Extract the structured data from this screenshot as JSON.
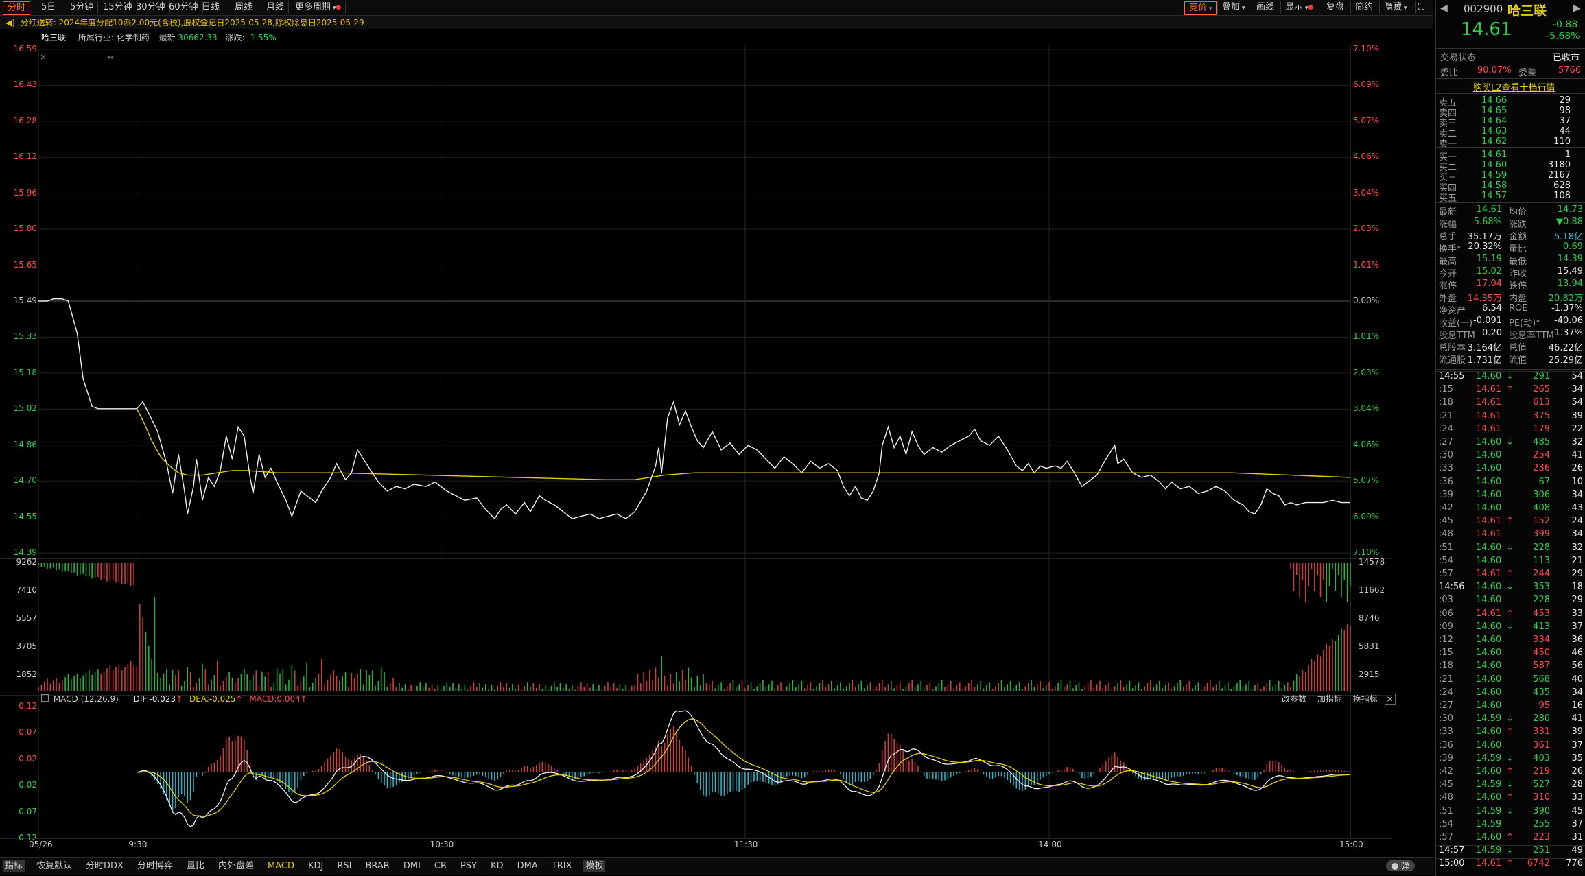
{
  "toolbar": {
    "period_tabs": [
      "分时",
      "5日",
      "5分钟",
      "15分钟",
      "30分钟",
      "60分钟",
      "日线",
      "周线",
      "月线",
      "更多周期"
    ],
    "right_tabs": [
      "竞价",
      "叠加",
      "画线",
      "显示",
      "复盘",
      "简约",
      "隐藏"
    ]
  },
  "notice": {
    "label": "分红送转:",
    "text": "2024年度分配10派2.00元(含税),股权登记日2025-05-28,除权除息日2025-05-29"
  },
  "info": {
    "name": "哈三联",
    "industry_label": "所属行业:",
    "industry": "化学制药",
    "latest_label": "最新",
    "latest": "30662.33",
    "change_label": "涨跌:",
    "change": "-1.55%"
  },
  "price_axis": {
    "left": [
      "16.59",
      "16.43",
      "16.28",
      "16.12",
      "15.96",
      "15.80",
      "15.65",
      "15.49",
      "15.33",
      "15.18",
      "15.02",
      "14.86",
      "14.70",
      "14.55",
      "14.39"
    ],
    "right": [
      "7.10%",
      "6.09%",
      "5.07%",
      "4.06%",
      "3.04%",
      "2.03%",
      "1.01%",
      "0.00%",
      "1.01%",
      "2.03%",
      "3.04%",
      "4.06%",
      "5.07%",
      "6.09%",
      "7.10%"
    ]
  },
  "volume_axis": {
    "left": [
      "9262",
      "7410",
      "5557",
      "3705",
      "1852"
    ],
    "right": [
      "14578",
      "11662",
      "8746",
      "5831",
      "2915"
    ]
  },
  "macd": {
    "label": "MACD (12,26,9)",
    "dif": "DIF:-0.023",
    "dea": "DEA:-0.025",
    "value": "MACD:0.004",
    "actions": [
      "改参数",
      "加指标",
      "换指标"
    ],
    "axis": [
      "0.12",
      "0.07",
      "0.02",
      "-0.02",
      "-0.07",
      "-0.12"
    ]
  },
  "time_axis": [
    "05/26",
    "9:30",
    "10:30",
    "11:30",
    "14:00",
    "15:00"
  ],
  "bottom_tabs": [
    "指标",
    "恢复默认",
    "分时DDX",
    "分时博弈",
    "量比",
    "内外盘差",
    "MACD",
    "KDJ",
    "RSI",
    "BRAR",
    "DMI",
    "CR",
    "PSY",
    "KD",
    "DMA",
    "TRIX",
    "模板"
  ],
  "bottom_right": "弹",
  "quote": {
    "code": "002900",
    "name": "哈三联",
    "price": "14.61",
    "change": "-0.88",
    "change_pct": "-5.68%",
    "trade_status_label": "交易状态",
    "trade_status": "已收市",
    "weibi_label": "委比",
    "weibi": "90.07%",
    "weicha_label": "委差",
    "weicha": "5766",
    "l2_link": "购买L2查看十档行情",
    "asks": [
      {
        "label": "卖五",
        "price": "14.66",
        "vol": "29"
      },
      {
        "label": "卖四",
        "price": "14.65",
        "vol": "98"
      },
      {
        "label": "卖三",
        "price": "14.64",
        "vol": "37"
      },
      {
        "label": "卖二",
        "price": "14.63",
        "vol": "44"
      },
      {
        "label": "卖一",
        "price": "14.62",
        "vol": "110"
      }
    ],
    "bids": [
      {
        "label": "买一",
        "price": "14.61",
        "vol": "1"
      },
      {
        "label": "买二",
        "price": "14.60",
        "vol": "3180"
      },
      {
        "label": "买三",
        "price": "14.59",
        "vol": "2167"
      },
      {
        "label": "买四",
        "price": "14.58",
        "vol": "628"
      },
      {
        "label": "买五",
        "price": "14.57",
        "vol": "108"
      }
    ],
    "stats": [
      {
        "l1": "最新",
        "v1": "14.61",
        "c1": "green",
        "l2": "均价",
        "v2": "14.73",
        "c2": "green"
      },
      {
        "l1": "涨幅",
        "v1": "-5.68%",
        "c1": "green",
        "l2": "涨跌",
        "v2": "▼0.88",
        "c2": "green"
      },
      {
        "l1": "总手",
        "v1": "35.17万",
        "c1": "white",
        "l2": "金额",
        "v2": "5.18亿",
        "c2": "cyan"
      },
      {
        "l1": "换手*",
        "v1": "20.32%",
        "c1": "white",
        "l2": "量比",
        "v2": "0.69",
        "c2": "green"
      },
      {
        "l1": "最高",
        "v1": "15.19",
        "c1": "green",
        "l2": "最低",
        "v2": "14.39",
        "c2": "green"
      },
      {
        "l1": "今开",
        "v1": "15.02",
        "c1": "green",
        "l2": "昨收",
        "v2": "15.49",
        "c2": "white"
      },
      {
        "l1": "涨停",
        "v1": "17.04",
        "c1": "red",
        "l2": "跌停",
        "v2": "13.94",
        "c2": "green"
      },
      {
        "l1": "外盘",
        "v1": "14.35万",
        "c1": "red",
        "l2": "内盘",
        "v2": "20.82万",
        "c2": "green"
      },
      {
        "l1": "净资产",
        "v1": "6.54",
        "c1": "white",
        "l2": "ROE",
        "v2": "-1.37%",
        "c2": "white"
      },
      {
        "l1": "收益(一)",
        "v1": "-0.091",
        "c1": "white",
        "l2": "PE(动)*",
        "v2": "-40.06",
        "c2": "white"
      },
      {
        "l1": "股息TTM",
        "v1": "0.20",
        "c1": "white",
        "l2": "股息率TTM",
        "v2": "1.37%",
        "c2": "white"
      },
      {
        "l1": "总股本",
        "v1": "3.164亿",
        "c1": "white",
        "l2": "总值",
        "v2": "46.22亿",
        "c2": "white"
      },
      {
        "l1": "流通股",
        "v1": "1.731亿",
        "c1": "white",
        "l2": "流值",
        "v2": "25.29亿",
        "c2": "white"
      }
    ],
    "ticks": [
      {
        "t": "14:55",
        "p": "14.60",
        "a": "↓",
        "v": "291",
        "n": "54",
        "c": "g",
        "m": true
      },
      {
        "t": ":15",
        "p": "14.61",
        "a": "↑",
        "v": "265",
        "n": "34",
        "c": "r"
      },
      {
        "t": ":18",
        "p": "14.61",
        "a": "",
        "v": "613",
        "n": "54",
        "c": "r"
      },
      {
        "t": ":21",
        "p": "14.61",
        "a": "",
        "v": "375",
        "n": "39",
        "c": "r"
      },
      {
        "t": ":24",
        "p": "14.61",
        "a": "",
        "v": "179",
        "n": "22",
        "c": "r"
      },
      {
        "t": ":27",
        "p": "14.60",
        "a": "↓",
        "v": "485",
        "n": "32",
        "c": "g"
      },
      {
        "t": ":30",
        "p": "14.60",
        "a": "",
        "v": "254",
        "n": "41",
        "c": "r"
      },
      {
        "t": ":33",
        "p": "14.60",
        "a": "",
        "v": "236",
        "n": "26",
        "c": "r"
      },
      {
        "t": ":36",
        "p": "14.60",
        "a": "",
        "v": "67",
        "n": "10",
        "c": "g"
      },
      {
        "t": ":39",
        "p": "14.60",
        "a": "",
        "v": "306",
        "n": "34",
        "c": "g"
      },
      {
        "t": ":42",
        "p": "14.60",
        "a": "",
        "v": "408",
        "n": "43",
        "c": "g"
      },
      {
        "t": ":45",
        "p": "14.61",
        "a": "↑",
        "v": "152",
        "n": "24",
        "c": "r"
      },
      {
        "t": ":48",
        "p": "14.61",
        "a": "",
        "v": "399",
        "n": "34",
        "c": "r"
      },
      {
        "t": ":51",
        "p": "14.60",
        "a": "↓",
        "v": "228",
        "n": "32",
        "c": "g"
      },
      {
        "t": ":54",
        "p": "14.60",
        "a": "",
        "v": "113",
        "n": "21",
        "c": "g"
      },
      {
        "t": ":57",
        "p": "14.61",
        "a": "↑",
        "v": "244",
        "n": "29",
        "c": "r"
      },
      {
        "t": "14:56",
        "p": "14.60",
        "a": "↓",
        "v": "353",
        "n": "18",
        "c": "g",
        "m": true
      },
      {
        "t": ":03",
        "p": "14.60",
        "a": "",
        "v": "228",
        "n": "29",
        "c": "g"
      },
      {
        "t": ":06",
        "p": "14.61",
        "a": "↑",
        "v": "453",
        "n": "33",
        "c": "r"
      },
      {
        "t": ":09",
        "p": "14.60",
        "a": "↓",
        "v": "413",
        "n": "37",
        "c": "g"
      },
      {
        "t": ":12",
        "p": "14.60",
        "a": "",
        "v": "334",
        "n": "36",
        "c": "r"
      },
      {
        "t": ":15",
        "p": "14.60",
        "a": "",
        "v": "450",
        "n": "46",
        "c": "r"
      },
      {
        "t": ":18",
        "p": "14.60",
        "a": "",
        "v": "587",
        "n": "56",
        "c": "r"
      },
      {
        "t": ":21",
        "p": "14.60",
        "a": "",
        "v": "568",
        "n": "40",
        "c": "g"
      },
      {
        "t": ":24",
        "p": "14.60",
        "a": "",
        "v": "435",
        "n": "34",
        "c": "g"
      },
      {
        "t": ":27",
        "p": "14.60",
        "a": "",
        "v": "95",
        "n": "16",
        "c": "r"
      },
      {
        "t": ":30",
        "p": "14.59",
        "a": "↓",
        "v": "280",
        "n": "41",
        "c": "g"
      },
      {
        "t": ":33",
        "p": "14.60",
        "a": "↑",
        "v": "331",
        "n": "39",
        "c": "r"
      },
      {
        "t": ":36",
        "p": "14.60",
        "a": "",
        "v": "361",
        "n": "37",
        "c": "r"
      },
      {
        "t": ":39",
        "p": "14.59",
        "a": "↓",
        "v": "403",
        "n": "35",
        "c": "g"
      },
      {
        "t": ":42",
        "p": "14.60",
        "a": "↑",
        "v": "219",
        "n": "26",
        "c": "r"
      },
      {
        "t": ":45",
        "p": "14.59",
        "a": "↓",
        "v": "527",
        "n": "28",
        "c": "g"
      },
      {
        "t": ":48",
        "p": "14.60",
        "a": "↑",
        "v": "310",
        "n": "33",
        "c": "r"
      },
      {
        "t": ":51",
        "p": "14.59",
        "a": "↓",
        "v": "390",
        "n": "45",
        "c": "g"
      },
      {
        "t": ":54",
        "p": "14.59",
        "a": "",
        "v": "255",
        "n": "37",
        "c": "g"
      },
      {
        "t": ":57",
        "p": "14.60",
        "a": "↑",
        "v": "223",
        "n": "31",
        "c": "r"
      },
      {
        "t": "14:57",
        "p": "14.59",
        "a": "↓",
        "v": "251",
        "n": "49",
        "c": "g",
        "m": true
      },
      {
        "t": "15:00",
        "p": "14.61",
        "a": "↑",
        "v": "6742",
        "n": "776",
        "c": "r",
        "m": true
      }
    ]
  },
  "chart_data": {
    "type": "line",
    "title": "",
    "price_range": [
      14.39,
      16.59
    ],
    "prev_close": 15.49,
    "price_path": [
      [
        0,
        15.49
      ],
      [
        3,
        15.49
      ],
      [
        5,
        15.5
      ],
      [
        8,
        15.5
      ],
      [
        10,
        15.49
      ],
      [
        13,
        15.35
      ],
      [
        15,
        15.15
      ],
      [
        18,
        15.03
      ],
      [
        20,
        15.02
      ],
      [
        30,
        15.02
      ],
      [
        33,
        15.02
      ],
      [
        35,
        15.05
      ],
      [
        37,
        15.0
      ],
      [
        40,
        14.92
      ],
      [
        43,
        14.78
      ],
      [
        45,
        14.65
      ],
      [
        47,
        14.82
      ],
      [
        49,
        14.66
      ],
      [
        50,
        14.56
      ],
      [
        52,
        14.68
      ],
      [
        53,
        14.8
      ],
      [
        55,
        14.62
      ],
      [
        57,
        14.72
      ],
      [
        59,
        14.68
      ],
      [
        61,
        14.75
      ],
      [
        63,
        14.9
      ],
      [
        65,
        14.8
      ],
      [
        67,
        14.94
      ],
      [
        69,
        14.9
      ],
      [
        71,
        14.72
      ],
      [
        72,
        14.65
      ],
      [
        74,
        14.82
      ],
      [
        76,
        14.72
      ],
      [
        78,
        14.76
      ],
      [
        80,
        14.7
      ],
      [
        83,
        14.62
      ],
      [
        85,
        14.55
      ],
      [
        88,
        14.66
      ],
      [
        90,
        14.64
      ],
      [
        93,
        14.61
      ],
      [
        95,
        14.66
      ],
      [
        98,
        14.72
      ],
      [
        100,
        14.78
      ],
      [
        103,
        14.71
      ],
      [
        105,
        14.74
      ],
      [
        107,
        14.84
      ],
      [
        109,
        14.8
      ],
      [
        111,
        14.76
      ],
      [
        114,
        14.7
      ],
      [
        117,
        14.66
      ],
      [
        120,
        14.68
      ],
      [
        123,
        14.67
      ],
      [
        126,
        14.69
      ],
      [
        130,
        14.68
      ],
      [
        133,
        14.7
      ],
      [
        137,
        14.66
      ],
      [
        140,
        14.64
      ],
      [
        143,
        14.62
      ],
      [
        147,
        14.63
      ],
      [
        150,
        14.58
      ],
      [
        153,
        14.54
      ],
      [
        155,
        14.58
      ],
      [
        157,
        14.6
      ],
      [
        160,
        14.56
      ],
      [
        163,
        14.61
      ],
      [
        165,
        14.57
      ],
      [
        168,
        14.64
      ],
      [
        170,
        14.62
      ],
      [
        173,
        14.6
      ],
      [
        176,
        14.57
      ],
      [
        179,
        14.54
      ],
      [
        182,
        14.55
      ],
      [
        185,
        14.56
      ],
      [
        188,
        14.54
      ],
      [
        191,
        14.55
      ],
      [
        194,
        14.56
      ],
      [
        197,
        14.54
      ],
      [
        200,
        14.57
      ],
      [
        204,
        14.66
      ],
      [
        207,
        14.77
      ],
      [
        208,
        14.85
      ],
      [
        209,
        14.74
      ],
      [
        211,
        14.98
      ],
      [
        213,
        15.05
      ],
      [
        215,
        14.95
      ],
      [
        217,
        15.01
      ],
      [
        219,
        14.94
      ],
      [
        221,
        14.88
      ],
      [
        223,
        14.85
      ],
      [
        226,
        14.92
      ],
      [
        229,
        14.84
      ],
      [
        232,
        14.87
      ],
      [
        235,
        14.82
      ],
      [
        238,
        14.86
      ],
      [
        241,
        14.84
      ],
      [
        244,
        14.8
      ],
      [
        247,
        14.76
      ],
      [
        250,
        14.81
      ],
      [
        253,
        14.78
      ],
      [
        256,
        14.74
      ],
      [
        259,
        14.79
      ],
      [
        262,
        14.76
      ],
      [
        265,
        14.78
      ],
      [
        268,
        14.75
      ],
      [
        270,
        14.68
      ],
      [
        272,
        14.64
      ],
      [
        274,
        14.68
      ],
      [
        276,
        14.63
      ],
      [
        278,
        14.62
      ],
      [
        280,
        14.66
      ],
      [
        282,
        14.74
      ],
      [
        283,
        14.86
      ],
      [
        285,
        14.94
      ],
      [
        287,
        14.85
      ],
      [
        289,
        14.9
      ],
      [
        291,
        14.82
      ],
      [
        293,
        14.92
      ],
      [
        295,
        14.86
      ],
      [
        297,
        14.82
      ],
      [
        300,
        14.85
      ],
      [
        303,
        14.83
      ],
      [
        306,
        14.86
      ],
      [
        309,
        14.88
      ],
      [
        312,
        14.9
      ],
      [
        314,
        14.93
      ],
      [
        316,
        14.88
      ],
      [
        319,
        14.86
      ],
      [
        322,
        14.9
      ],
      [
        325,
        14.84
      ],
      [
        328,
        14.77
      ],
      [
        330,
        14.75
      ],
      [
        332,
        14.78
      ],
      [
        334,
        14.74
      ],
      [
        336,
        14.77
      ],
      [
        338,
        14.76
      ],
      [
        341,
        14.77
      ],
      [
        343,
        14.76
      ],
      [
        345,
        14.79
      ],
      [
        347,
        14.75
      ],
      [
        350,
        14.68
      ],
      [
        352,
        14.7
      ],
      [
        355,
        14.73
      ],
      [
        358,
        14.8
      ],
      [
        361,
        14.86
      ],
      [
        362,
        14.78
      ],
      [
        364,
        14.8
      ],
      [
        367,
        14.74
      ],
      [
        370,
        14.72
      ],
      [
        373,
        14.73
      ],
      [
        376,
        14.7
      ],
      [
        378,
        14.67
      ],
      [
        380,
        14.7
      ],
      [
        383,
        14.67
      ],
      [
        386,
        14.68
      ],
      [
        389,
        14.65
      ],
      [
        392,
        14.66
      ],
      [
        395,
        14.68
      ],
      [
        398,
        14.66
      ],
      [
        401,
        14.62
      ],
      [
        404,
        14.6
      ],
      [
        406,
        14.57
      ],
      [
        408,
        14.56
      ],
      [
        410,
        14.6
      ],
      [
        412,
        14.67
      ],
      [
        414,
        14.65
      ],
      [
        416,
        14.64
      ],
      [
        418,
        14.6
      ],
      [
        420,
        14.61
      ],
      [
        422,
        14.6
      ],
      [
        425,
        14.61
      ],
      [
        428,
        14.61
      ],
      [
        431,
        14.61
      ],
      [
        434,
        14.62
      ],
      [
        437,
        14.61
      ],
      [
        440,
        14.61
      ]
    ],
    "avg_path": [
      [
        33,
        15.02
      ],
      [
        35,
        14.97
      ],
      [
        38,
        14.88
      ],
      [
        41,
        14.81
      ],
      [
        44,
        14.77
      ],
      [
        47,
        14.74
      ],
      [
        50,
        14.73
      ],
      [
        55,
        14.73
      ],
      [
        60,
        14.74
      ],
      [
        65,
        14.75
      ],
      [
        70,
        14.75
      ],
      [
        80,
        14.74
      ],
      [
        100,
        14.74
      ],
      [
        130,
        14.73
      ],
      [
        160,
        14.72
      ],
      [
        190,
        14.71
      ],
      [
        200,
        14.71
      ],
      [
        205,
        14.72
      ],
      [
        210,
        14.73
      ],
      [
        220,
        14.74
      ],
      [
        260,
        14.74
      ],
      [
        300,
        14.74
      ],
      [
        350,
        14.74
      ],
      [
        400,
        14.74
      ],
      [
        420,
        14.73
      ],
      [
        440,
        14.72
      ]
    ],
    "volume_range": [
      0,
      9262
    ],
    "macd_range": [
      -0.12,
      0.12
    ]
  }
}
